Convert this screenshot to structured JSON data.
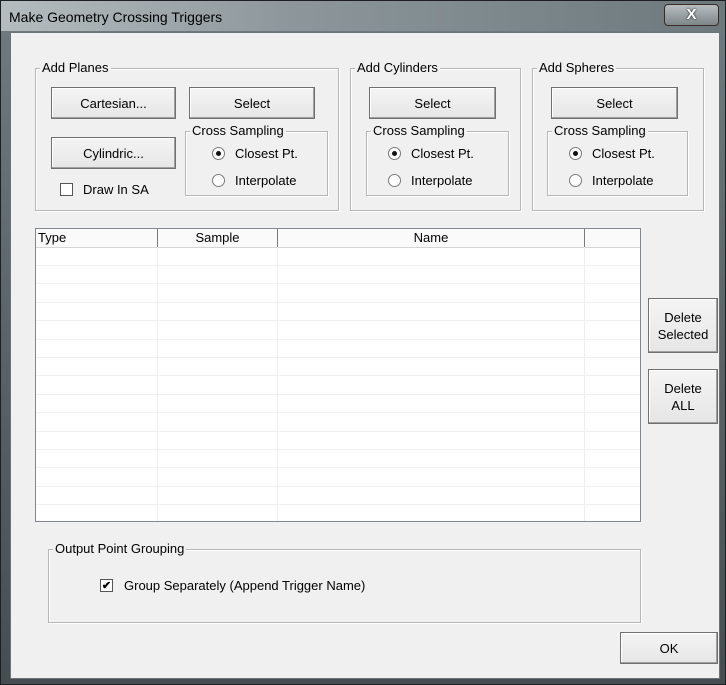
{
  "window": {
    "title": "Make Geometry Crossing Triggers",
    "close_glyph": "X"
  },
  "add_planes": {
    "legend": "Add Planes",
    "cartesian_label": "Cartesian...",
    "cylindric_label": "Cylindric...",
    "select_label": "Select",
    "draw_in_sa_label": "Draw In SA",
    "draw_in_sa_checked": false,
    "cross_sampling": {
      "legend": "Cross Sampling",
      "closest_label": "Closest Pt.",
      "interpolate_label": "Interpolate",
      "selected": "closest"
    }
  },
  "add_cylinders": {
    "legend": "Add Cylinders",
    "select_label": "Select",
    "cross_sampling": {
      "legend": "Cross Sampling",
      "closest_label": "Closest Pt.",
      "interpolate_label": "Interpolate",
      "selected": "closest"
    }
  },
  "add_spheres": {
    "legend": "Add Spheres",
    "select_label": "Select",
    "cross_sampling": {
      "legend": "Cross Sampling",
      "closest_label": "Closest Pt.",
      "interpolate_label": "Interpolate",
      "selected": "closest"
    }
  },
  "list": {
    "columns": [
      "Type",
      "Sample",
      "Name",
      ""
    ],
    "rows": []
  },
  "delete_selected_label": "Delete Selected",
  "delete_all_label": "Delete ALL",
  "output_grouping": {
    "legend": "Output Point Grouping",
    "group_separately_label": "Group Separately (Append Trigger Name)",
    "group_separately_checked": true
  },
  "ok_label": "OK",
  "icons": {
    "checkmark": "✔"
  }
}
